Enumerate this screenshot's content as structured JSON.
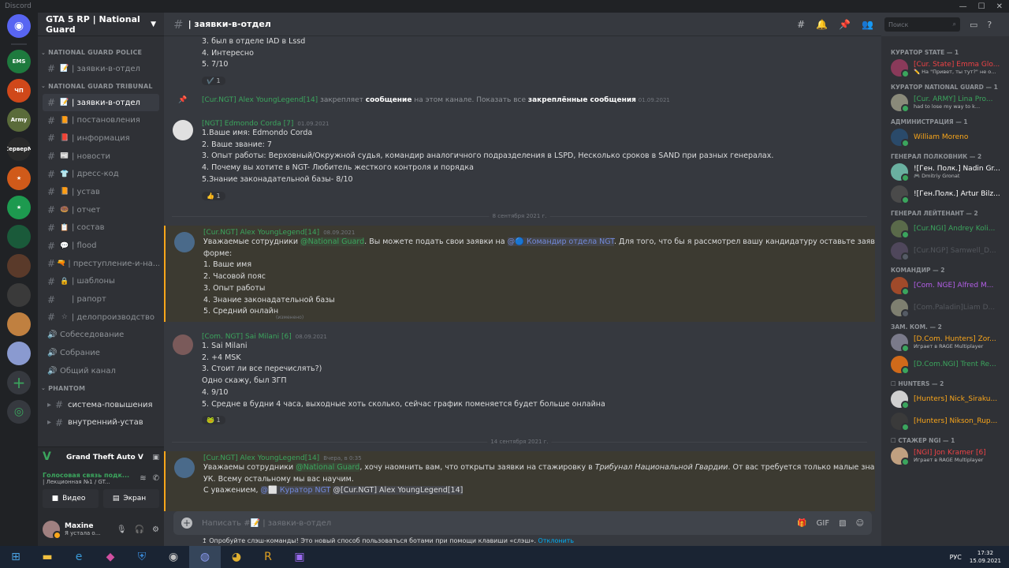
{
  "window": {
    "title": "Discord"
  },
  "server": {
    "name": "GTA 5 RP | National Guard"
  },
  "guild_icons": [
    {
      "label": "",
      "color": "#5865f2",
      "icon": "discord-icon"
    },
    {
      "label": "EMS",
      "color": "#1e7a3e"
    },
    {
      "label": "ЧП",
      "color": "#d0481a"
    },
    {
      "label": "Army",
      "color": "#5a6b3a"
    },
    {
      "label": "СерверМ",
      "color": "#2a2a2a"
    },
    {
      "label": "★",
      "color": "#d05a1a"
    },
    {
      "label": "★",
      "color": "#1d9a4f"
    },
    {
      "label": "",
      "color": "#1a5a3a"
    },
    {
      "label": "",
      "color": "#5a3a2a"
    },
    {
      "label": "",
      "color": "#3a3a3a"
    },
    {
      "label": "",
      "color": "#c08040"
    },
    {
      "label": "",
      "color": "#8a9ad0"
    }
  ],
  "categories": {
    "police": "NATIONAL GUARD POLICE",
    "tribunal": "NATIONAL GUARD TRIBUNAL",
    "phantom": "PHANTOM"
  },
  "channels_police": [
    {
      "emoji": "📝",
      "name": "| заявки-в-отдел"
    }
  ],
  "channels_tribunal": [
    {
      "emoji": "📝",
      "name": "| заявки-в-отдел",
      "active": true
    },
    {
      "emoji": "📙",
      "name": "| постановления"
    },
    {
      "emoji": "📕",
      "name": "| информация"
    },
    {
      "emoji": "📰",
      "name": "| новости"
    },
    {
      "emoji": "👕",
      "name": "| дресс-код"
    },
    {
      "emoji": "📙",
      "name": "| устав"
    },
    {
      "emoji": "🍩",
      "name": "| отчет"
    },
    {
      "emoji": "📋",
      "name": "| состав"
    },
    {
      "emoji": "💬",
      "name": "| flood"
    },
    {
      "emoji": "🔫",
      "name": "| преступление-и-на..."
    },
    {
      "emoji": "🔒",
      "name": "| шаблоны"
    },
    {
      "emoji": "",
      "name": "| рапорт"
    },
    {
      "emoji": "☆",
      "name": "| делопроизводство"
    }
  ],
  "voice_channels": [
    {
      "name": "Собеседование"
    },
    {
      "name": "Собрание"
    },
    {
      "name": "Общий канал"
    }
  ],
  "channels_phantom": [
    {
      "name": "система-повышения"
    },
    {
      "name": "внутренний-устав"
    }
  ],
  "game": {
    "name": "Grand Theft Auto V"
  },
  "voice": {
    "title": "Голосовая связь подк...",
    "sub": "| Лекционная №1 / GT...",
    "video": "Видео",
    "screen": "Экран"
  },
  "user": {
    "name": "Maxine",
    "status": "Я устала о..."
  },
  "channel": {
    "name": "| заявки-в-отдел"
  },
  "search": {
    "placeholder": "Поиск"
  },
  "messages": {
    "m0": {
      "lines": [
        "3. был в отделе IAD в Lssd",
        "4. Интересно",
        "5. 7/10"
      ],
      "reaction": "✔️ 1"
    },
    "sys": {
      "author": "[Cur.NGT] Alex YoungLegend[14]",
      "t1": "закрепляет",
      "b1": "сообщение",
      "t2": "на этом канале. Показать все",
      "b2": "закреплённые сообщения",
      "ts": "01.09.2021"
    },
    "m1": {
      "author": "[NGT] Edmondo Corda [7]",
      "ts": "01.09.2021",
      "lines": [
        "1.Ваше имя: Edmondo Corda",
        "2. Ваше звание: 7",
        "3. Опыт работы: Верховный/Окружной судья, командир аналогичного подразделения в LSPD, Несколько сроков в SAND при разных генералах.",
        "4. Почему вы хотите в NGT- Любитель жесткого контроля и порядка",
        "5.Знание законадательной базы- 8/10"
      ],
      "reaction": "👍 1"
    },
    "sep1": "8 сентября 2021 г.",
    "m2": {
      "author": "[Cur.NGT] Alex YoungLegend[14]",
      "ts": "08.09.2021",
      "l1a": "Уважаемые сотрудники ",
      "l1m": "@National Guard",
      "l1b": ". Вы можете подать свои заявки на ",
      "l1m2": "@🔵 Командир отдела NGT",
      "l1c": ". Для того, что бы я рассмотрел вашу кандидатуру оставьте заявку по",
      "lines": [
        "форме:",
        "1. Ваше имя",
        "2. Часовой пояс",
        "3. Опыт работы",
        "4. Знание законадательной базы",
        "5. Средний онлайн"
      ],
      "edited": "(изменено)"
    },
    "m3": {
      "author": "[Com. NGT] Sai Milani [6]",
      "ts": "08.09.2021",
      "lines": [
        "1. Sai Milani",
        "2. +4 MSK",
        "3. Стоит ли все перечислять?)",
        "Одно скажу, был ЗГП",
        "4. 9/10",
        "5. Средне в будни 4 часа, выходные хоть сколько, сейчас график поменяется будет больше онлайна"
      ],
      "reaction": "🐸 1"
    },
    "sep2": "14 сентября 2021 г.",
    "m4": {
      "author": "[Cur.NGT] Alex YoungLegend[14]",
      "ts": "Вчера, в 0:35",
      "l1a": "Уважаемы сотрудники ",
      "l1m": "@National Guard",
      "l1b": ", хочу наомнить вам, что открыты заявки на стажировку в ",
      "l1i": "Трибунал Национальной Гвардии",
      "l1c": ". От вас требуется только малые знания",
      "l2": "УК. Всему остальному мы вас научим.",
      "l3": "С уважением, ",
      "l3m": "@⬜ Куратор NGT",
      "l3m2": "@[Cur.NGT] Alex YoungLegend[14]"
    }
  },
  "composer": {
    "placeholder": "Написать #📝 | заявки-в-отдел"
  },
  "hint": {
    "text": "Опробуйте слэш-команды! Это новый способ пользоваться ботами при помощи клавиши «слэш». ",
    "link": "Отклонить"
  },
  "member_groups": [
    {
      "role": "КУРАТОР STATE — 1",
      "members": [
        {
          "name": "[Cur. State] Emma Glo...",
          "sub": "✏️ На \"Привет, ты тут?\" не о...",
          "color": "#ed4245",
          "av": "#8a3a5a"
        }
      ]
    },
    {
      "role": "КУРАТОР NATIONAL GUARD — 1",
      "members": [
        {
          "name": "[Cur. ARMY] Lina Pro...",
          "sub": "had to lose my way to k...",
          "color": "#3ba55d",
          "av": "#8a8a7a"
        }
      ]
    },
    {
      "role": "АДМИНИСТРАЦИЯ — 1",
      "members": [
        {
          "name": "William Moreno",
          "sub": "",
          "color": "#faa61a",
          "av": "#2a4a6a"
        }
      ]
    },
    {
      "role": "ГЕНЕРАЛ ПОЛКОВНИК — 2",
      "members": [
        {
          "name": "![Ген. Полк.] Nadin Gr...",
          "sub": "🎮 Dmitriy Gronat",
          "color": "#ffffff",
          "av": "#6ab0a0"
        },
        {
          "name": "![Ген.Полк.] Artur Bilz...",
          "sub": "",
          "color": "#ffffff",
          "av": "#4a4a4a"
        }
      ]
    },
    {
      "role": "ГЕНЕРАЛ ЛЕЙТЕНАНТ — 2",
      "members": [
        {
          "name": "[Cur.NGI] Andrey Koli...",
          "sub": "",
          "color": "#3ba55d",
          "av": "#5a6a4a"
        },
        {
          "name": "[Cur.NGP] Samwell_D...",
          "sub": "",
          "color": "#72767d",
          "av": "#6a5a7a"
        }
      ]
    },
    {
      "role": "КОМАНДИР — 2",
      "members": [
        {
          "name": "[Com. NGE] Alfred M...",
          "sub": "",
          "color": "#b45ee8",
          "av": "#a04a2a"
        },
        {
          "name": "[Com.Paladin]Liam D...",
          "sub": "",
          "color": "#72767d",
          "av": "#c0c0a0"
        }
      ]
    },
    {
      "role": "ЗАМ. КОМ. — 2",
      "members": [
        {
          "name": "[D.Com. Hunters] Zor...",
          "sub": "Играет в RAGE Multiplayer",
          "color": "#faa61a",
          "av": "#7a7a8a"
        },
        {
          "name": "[D.Com.NGI] Trent Re...",
          "sub": "",
          "color": "#3ba55d",
          "av": "#d06a1a"
        }
      ]
    },
    {
      "role": "☐ HUNTERS — 2",
      "members": [
        {
          "name": "[Hunters] Nick_Siraku...",
          "sub": "",
          "color": "#faa61a",
          "av": "#d0d0d0"
        },
        {
          "name": "[Hunters] Nikson_Rup...",
          "sub": "",
          "color": "#faa61a",
          "av": "#3a3a3a"
        }
      ]
    },
    {
      "role": "☐ СТАЖЕР NGI — 1",
      "members": [
        {
          "name": "[NGI] Jon Kramer [6]",
          "sub": "Играет в RAGE Multiplayer",
          "color": "#ed4245",
          "av": "#c0a080"
        }
      ]
    }
  ],
  "taskbar": {
    "lang": "РУС",
    "time": "17:32",
    "date": "15.09.2021"
  }
}
